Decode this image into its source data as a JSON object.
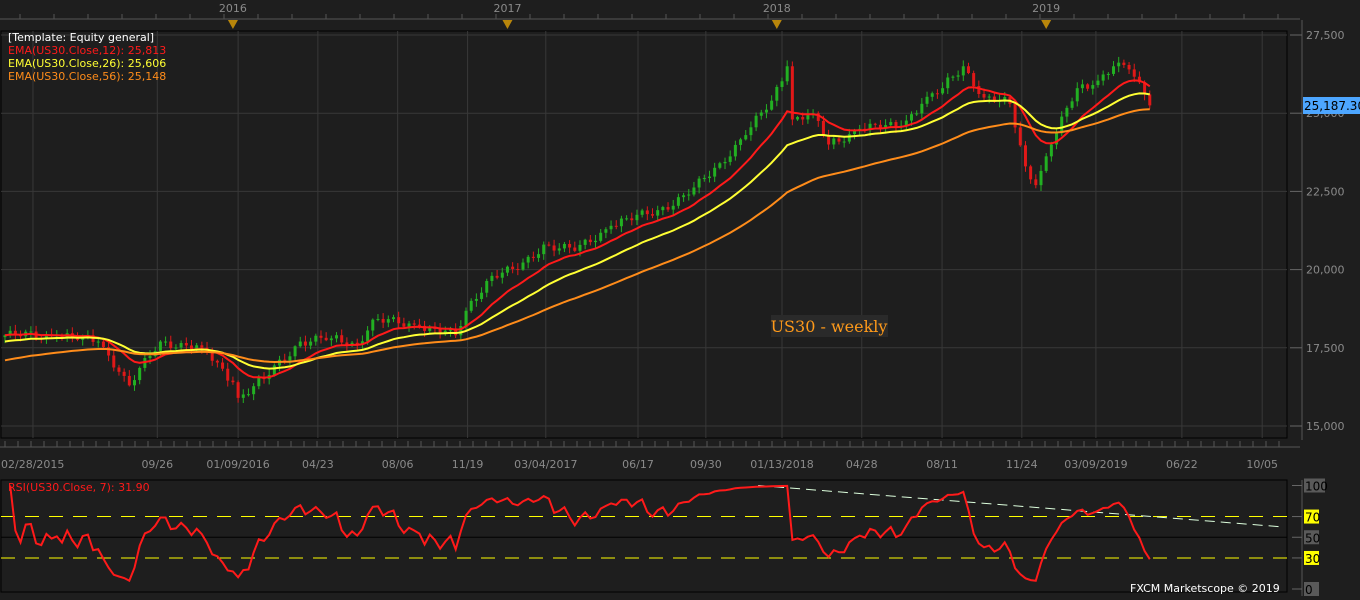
{
  "chart_data": {
    "type": "candlestick",
    "title": "US30 - weekly",
    "template_label": "[Template: Equity general]",
    "indicators": [
      {
        "label": "EMA(US30.Close,12): 25,813",
        "period": 12,
        "color": "#ff1a1a"
      },
      {
        "label": "EMA(US30.Close,26): 25,606",
        "period": 26,
        "color": "#ffff33"
      },
      {
        "label": "EMA(US30.Close,56): 25,148",
        "period": 56,
        "color": "#ff8c1a"
      }
    ],
    "current_price_label": "25,187.30",
    "ylim": [
      15000,
      27500
    ],
    "y_ticks": [
      "15,000",
      "17,500",
      "20,000",
      "22,500",
      "25,000",
      "27,500"
    ],
    "y_tick_values": [
      15000,
      17500,
      20000,
      22500,
      25000,
      27500
    ],
    "year_markers": [
      "2016",
      "2017",
      "2018",
      "2019"
    ],
    "year_marker_weeks": [
      44,
      97,
      149,
      201
    ],
    "x_tick_labels": [
      "02/28/2015",
      "09/26",
      "01/09/2016",
      "04/23",
      "08/06",
      "11/19",
      "03/04/2017",
      "06/17",
      "09/30",
      "01/13/2018",
      "04/28",
      "08/11",
      "11/24",
      "03/09/2019",
      "06/22",
      "10/05"
    ],
    "x_tick_weeks": [
      5.4,
      29.4,
      45,
      60.4,
      75.8,
      89.3,
      104.4,
      122.2,
      135.3,
      150,
      165.4,
      180.9,
      196.3,
      210.6,
      227.2,
      242.7
    ],
    "total_weeks": 247,
    "close_keypoints_week": [
      0,
      10,
      18,
      23,
      24,
      30,
      38,
      44,
      45,
      50,
      57,
      63,
      68,
      71,
      80,
      87,
      90,
      94,
      99,
      104,
      110,
      117,
      126,
      132,
      138,
      143,
      148,
      151,
      152,
      156,
      159,
      165,
      173,
      177,
      181,
      185,
      189,
      194,
      197,
      199,
      202,
      207,
      210,
      214,
      217,
      220,
      221
    ],
    "close_keypoints_value": [
      17900,
      17900,
      17700,
      16600,
      16300,
      17700,
      17500,
      16400,
      15900,
      16500,
      17700,
      17800,
      17600,
      18400,
      18200,
      17900,
      19000,
      19800,
      20000,
      20800,
      20600,
      21400,
      21900,
      22400,
      23400,
      24300,
      25400,
      26500,
      24800,
      25000,
      24000,
      24500,
      24600,
      25300,
      25800,
      26500,
      25500,
      25300,
      23300,
      22700,
      24000,
      25800,
      25900,
      26500,
      26400,
      25600,
      25250
    ],
    "rsi": {
      "label": "RSI(US30.Close, 7): 31.90",
      "period": 7,
      "levels": [
        30,
        70
      ],
      "y_ticks": [
        "100",
        "70",
        "50",
        "30",
        "0"
      ],
      "y_tick_values": [
        100,
        70,
        50,
        30,
        0
      ],
      "trendline_weeks": [
        145.4,
        246.6
      ],
      "trendline_values": [
        100,
        60
      ]
    }
  },
  "watermark": "FXCM Marketscope © 2019",
  "colors": {
    "up": "#22b022",
    "down": "#e01818",
    "rsi": "#ff1a1a",
    "price_tag": "#4da6ff",
    "level": "#ffff00"
  }
}
